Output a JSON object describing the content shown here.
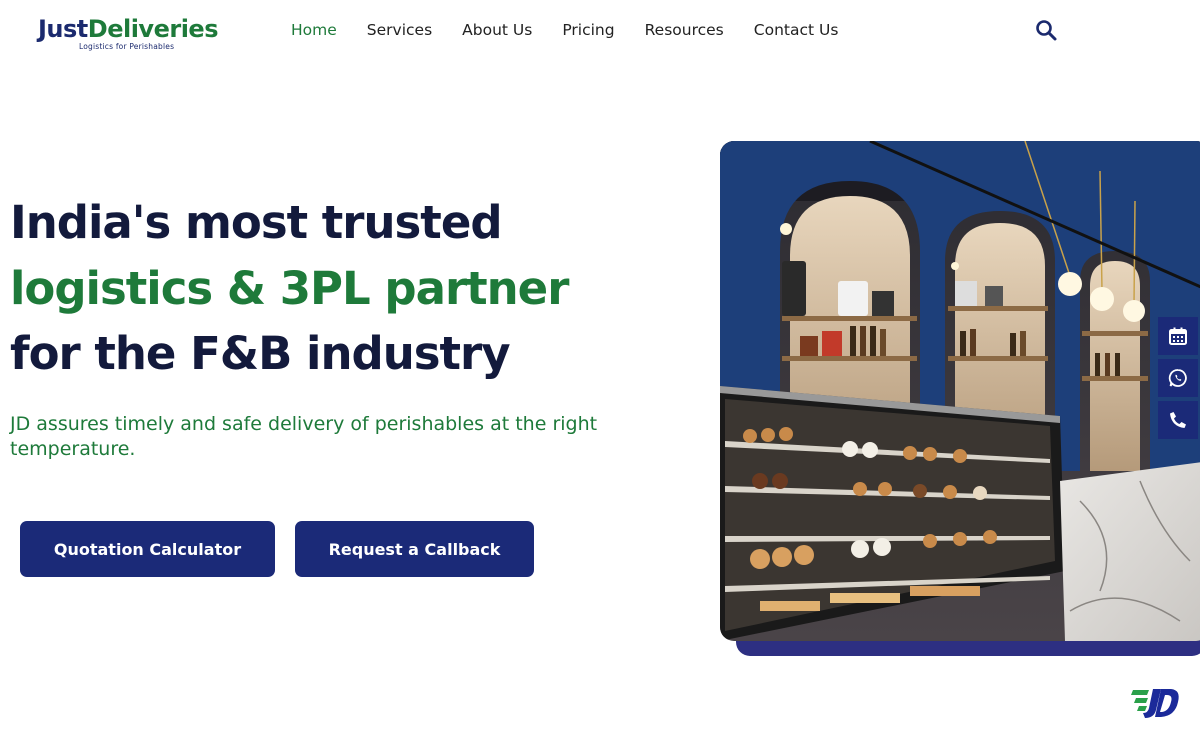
{
  "header": {
    "logo_part1": "Just",
    "logo_part2": "Deliveries",
    "logo_tagline": "Logistics for Perishables",
    "nav": [
      {
        "label": "Home",
        "active": true
      },
      {
        "label": "Services",
        "active": false
      },
      {
        "label": "About Us",
        "active": false
      },
      {
        "label": "Pricing",
        "active": false
      },
      {
        "label": "Resources",
        "active": false
      },
      {
        "label": "Contact Us",
        "active": false
      }
    ],
    "search_icon": "search-icon"
  },
  "hero": {
    "line1": "India's most trusted",
    "line2": "logistics & 3PL partner",
    "line3": "for the F&B industry",
    "subtitle": "JD assures timely and safe delivery of perishables at the right temperature.",
    "btn_quotation": "Quotation Calculator",
    "btn_callback": "Request a Callback",
    "image_icon": "bakery-display-photo"
  },
  "side_actions": [
    {
      "icon": "calendar-icon"
    },
    {
      "icon": "whatsapp-icon"
    },
    {
      "icon": "phone-icon"
    }
  ],
  "badge": {
    "icon": "jd-logo-icon"
  },
  "colors": {
    "navy": "#1b2a78",
    "green": "#1e7a3a",
    "heading": "#131a3c"
  }
}
